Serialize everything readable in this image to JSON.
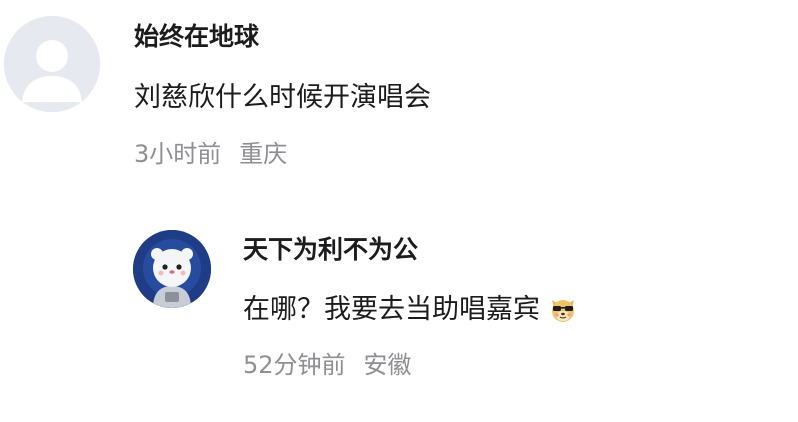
{
  "comments": [
    {
      "username": "始终在地球",
      "content": "刘慈欣什么时候开演唱会",
      "time": "3小时前",
      "location": "重庆",
      "avatar": "default-user-avatar"
    }
  ],
  "reply": {
    "username": "天下为利不为公",
    "content": "在哪？我要去当助唱嘉宾",
    "emoji": "cool-dog-sunglasses-emoji",
    "time": "52分钟前",
    "location": "安徽",
    "avatar": "astronaut-bear-avatar"
  },
  "colors": {
    "username": "#1c1c1e",
    "content": "#1c1c1e",
    "meta": "#8e8e93",
    "default_avatar_bg": "#e6e9ef",
    "bear_avatar_bg": "#1f3d86"
  }
}
